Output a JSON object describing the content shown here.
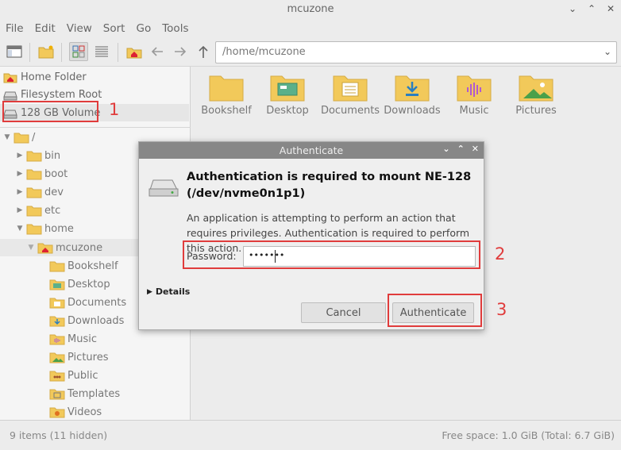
{
  "window": {
    "title": "mcuzone"
  },
  "menu": [
    "File",
    "Edit",
    "View",
    "Sort",
    "Go",
    "Tools"
  ],
  "path": {
    "value": "/home/mcuzone"
  },
  "places": [
    {
      "label": "Home Folder",
      "icon": "home-icon"
    },
    {
      "label": "Filesystem Root",
      "icon": "drive-icon"
    },
    {
      "label": "128 GB Volume",
      "icon": "drive-icon"
    }
  ],
  "tree": [
    {
      "label": "/",
      "depth": 0,
      "expanded": true
    },
    {
      "label": "bin",
      "depth": 1
    },
    {
      "label": "boot",
      "depth": 1
    },
    {
      "label": "dev",
      "depth": 1
    },
    {
      "label": "etc",
      "depth": 1
    },
    {
      "label": "home",
      "depth": 1,
      "expanded": true
    },
    {
      "label": "mcuzone",
      "depth": 2,
      "expanded": true,
      "selected": true
    },
    {
      "label": "Bookshelf",
      "depth": 3
    },
    {
      "label": "Desktop",
      "depth": 3
    },
    {
      "label": "Documents",
      "depth": 3
    },
    {
      "label": "Downloads",
      "depth": 3
    },
    {
      "label": "Music",
      "depth": 3
    },
    {
      "label": "Pictures",
      "depth": 3
    },
    {
      "label": "Public",
      "depth": 3
    },
    {
      "label": "Templates",
      "depth": 3
    },
    {
      "label": "Videos",
      "depth": 3
    }
  ],
  "files": [
    "Bookshelf",
    "Desktop",
    "Documents",
    "Downloads",
    "Music",
    "Pictures"
  ],
  "status": {
    "left": "9 items (11 hidden)",
    "right": "Free space: 1.0 GiB (Total: 6.7 GiB)"
  },
  "dialog": {
    "title": "Authenticate",
    "heading": "Authentication is required to mount NE-128 (/dev/nvme0n1p1)",
    "body": "An application is attempting to perform an action that requires privileges. Authentication is required to perform this action.",
    "password_label": "Password:",
    "password_mask": "•••••••",
    "details_label": "Details",
    "cancel_label": "Cancel",
    "authenticate_label": "Authenticate"
  },
  "annotations": [
    "1",
    "2",
    "3"
  ],
  "colors": {
    "highlight": "#e03c3c",
    "folder": "#f2c95a"
  }
}
